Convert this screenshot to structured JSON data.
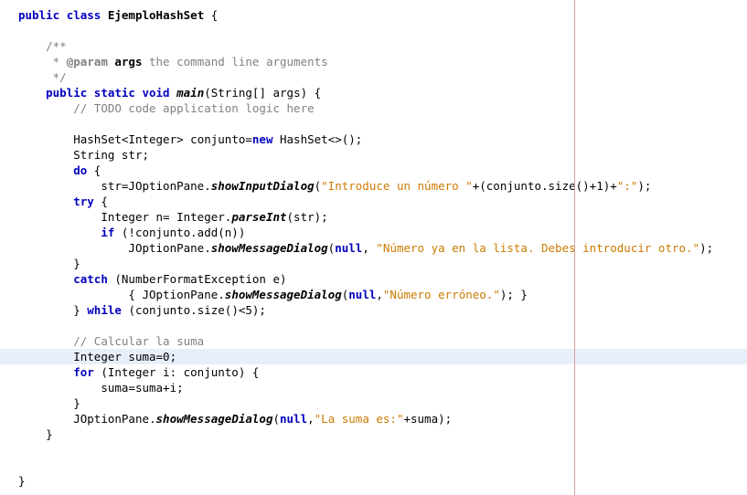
{
  "code": {
    "class_decl": {
      "public": "public",
      "class": "class",
      "name": "EjemploHashSet",
      "brace": " {"
    },
    "javadoc": {
      "open": "/**",
      "param_line": " * ",
      "tag": "@param",
      "param_name": " args",
      "param_desc": " the command line arguments",
      "close": " */"
    },
    "method": {
      "public": "public",
      "static": "static",
      "void": "void",
      "name": "main",
      "params": "(String[] args) {"
    },
    "todo_comment": "// TODO code application logic here",
    "hashset_decl": {
      "type": "HashSet<Integer>",
      "var": " conjunto=",
      "new": "new",
      "ctor": " HashSet<>();"
    },
    "string_decl": "String str;",
    "do": "do",
    "do_brace": " {",
    "input_line": {
      "lhs": "    str=JOptionPane.",
      "method": "showInputDialog",
      "paren": "(",
      "str1": "\"Introduce un número \"",
      "mid": "+(conjunto.size()+1)+",
      "str2": "\":\"",
      "end": ");"
    },
    "try": "try",
    "try_brace": " {",
    "parse_line": {
      "lhs": "    Integer n= Integer.",
      "method": "parseInt",
      "end": "(str);"
    },
    "if_line": {
      "if": "if",
      "cond": " (!conjunto.add(n))"
    },
    "msg1_line": {
      "lhs": "        JOptionPane.",
      "method": "showMessageDialog",
      "paren": "(",
      "null": "null",
      "comma": ", ",
      "str": "\"Número ya en la lista. Debes introducir otro.\"",
      "end": ");"
    },
    "close_brace1": "}",
    "catch": "catch",
    "catch_params": " (NumberFormatException e)",
    "catch_body": {
      "open": "        { JOptionPane.",
      "method": "showMessageDialog",
      "paren": "(",
      "null": "null",
      "comma": ",",
      "str": "\"Número erróneo.\"",
      "end": "); }"
    },
    "while_line": {
      "close": "} ",
      "while": "while",
      "cond": " (conjunto.size()<5);"
    },
    "calc_comment": "// Calcular la suma",
    "suma_decl": "Integer suma=0;",
    "for": "for",
    "for_params": " (Integer i: conjunto) {",
    "for_body": "    suma=suma+i;",
    "for_close": "}",
    "final_msg": {
      "lhs": "JOptionPane.",
      "method": "showMessageDialog",
      "paren": "(",
      "null": "null",
      "comma": ",",
      "str": "\"La suma es:\"",
      "end": "+suma);"
    },
    "method_close": "}",
    "class_close": "}"
  }
}
